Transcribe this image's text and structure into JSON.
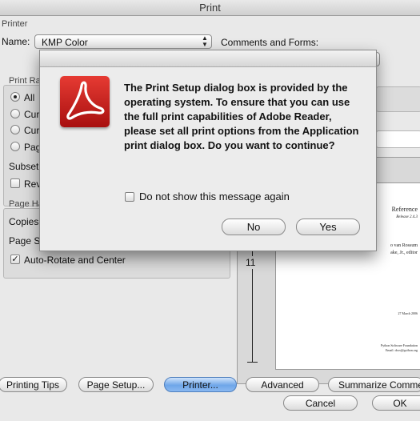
{
  "window": {
    "title": "Print"
  },
  "printer_section": {
    "label": "Printer",
    "name_label": "Name:",
    "printer_value": "KMP Color",
    "comments_label": "Comments and Forms:"
  },
  "print_range": {
    "label": "Print Ra",
    "options": [
      "All",
      "Cur",
      "Cur",
      "Pag"
    ],
    "subset_label": "Subset",
    "reverse_label": "Rev"
  },
  "page_handling": {
    "label": "Page Ha",
    "copies_label": "Copies",
    "page_scaling_label": "Page Sc",
    "auto_rotate_label": "Auto-Rotate and Center"
  },
  "preview": {
    "ruler_number": "11",
    "page_lines": [
      "Reference",
      "Release 2.4.3",
      "o van Rossum",
      "ake, Jr., editor",
      "27 March 2006",
      "Python Software Foundation",
      "Email: docs@python.org"
    ]
  },
  "buttons": {
    "printing_tips": "Printing Tips",
    "page_setup": "Page Setup...",
    "printer": "Printer...",
    "advanced": "Advanced",
    "summarize": "Summarize Comme",
    "cancel": "Cancel",
    "ok": "OK"
  },
  "dialog": {
    "message": "The Print Setup dialog box is provided by the operating system. To ensure that you can use the full print capabilities of Adobe Reader, please set all print options from the Application print dialog box. Do you want to continue?",
    "checkbox_label": "Do not show this message again",
    "no_label": "No",
    "yes_label": "Yes"
  },
  "colors": {
    "accent_blue": "#6fa6e9",
    "acrobat_red": "#c4161c"
  }
}
